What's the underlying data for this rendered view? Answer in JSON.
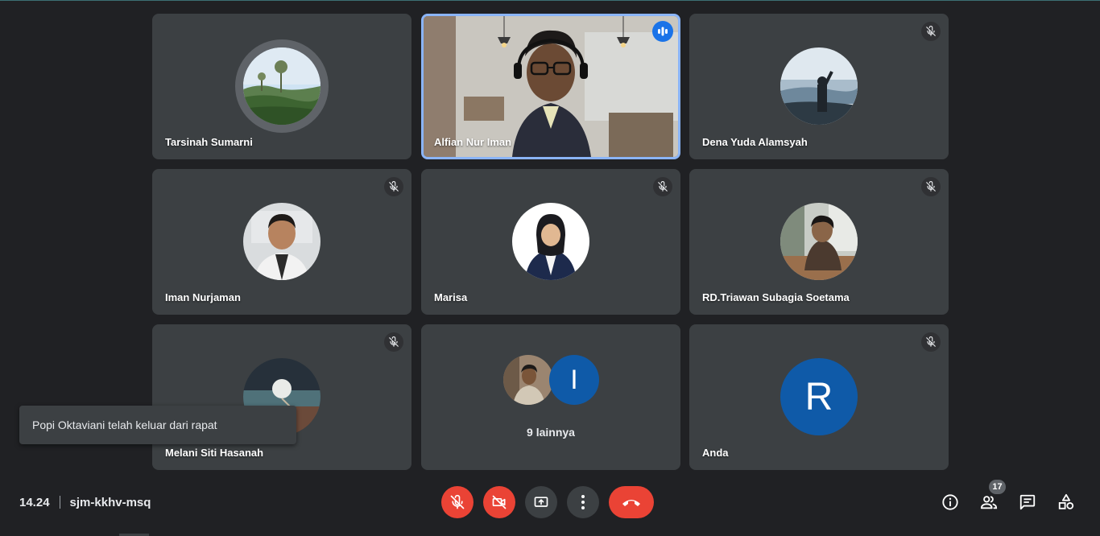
{
  "participants": [
    {
      "name": "Tarsinah Sumarni",
      "state": "no-badge"
    },
    {
      "name": "Alfian Nur Iman",
      "state": "speaking"
    },
    {
      "name": "Dena Yuda Alamsyah",
      "state": "muted"
    },
    {
      "name": "Iman Nurjaman",
      "state": "muted"
    },
    {
      "name": "Marisa",
      "state": "muted"
    },
    {
      "name": "RD.Triawan Subagia Soetama",
      "state": "muted"
    },
    {
      "name": "Melani Siti Hasanah",
      "state": "muted"
    }
  ],
  "others_tile": {
    "initial": "I",
    "label": "9 lainnya"
  },
  "self_tile": {
    "initial": "R",
    "name": "Anda",
    "state": "muted"
  },
  "toast": {
    "message": "Popi Oktaviani telah keluar dari rapat"
  },
  "meeting": {
    "time": "14.24",
    "code": "sjm-kkhv-msq"
  },
  "participant_count": "17",
  "controls": [
    "mic-off-icon",
    "camera-off-icon",
    "present-screen-icon",
    "more-options-icon",
    "hang-up-icon"
  ],
  "side_controls": [
    "info-icon",
    "people-icon",
    "chat-icon",
    "activities-icon"
  ],
  "colors": {
    "background": "#202124",
    "tile": "#3c4043",
    "danger": "#ea4335",
    "active_border": "#8ab4f8",
    "speaking": "#1a73e8",
    "letter_avatar": "#0f5aa8"
  }
}
